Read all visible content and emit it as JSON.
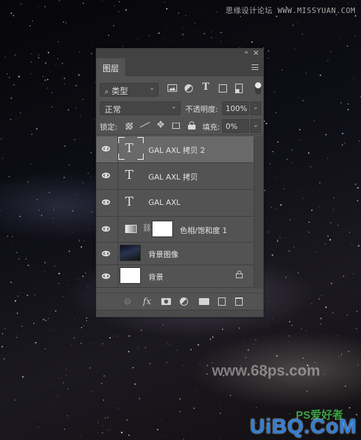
{
  "watermarks": {
    "top_right": "思缘设计论坛 WWW.MISSYUAN.COM",
    "center": "www.68ps.com",
    "bottom_ps": "PS爱好者",
    "bottom_uibq": "UiBQ.CoM"
  },
  "panel": {
    "collapse_icon": "«",
    "close_icon": "✕",
    "tab_label": "图层",
    "filter": {
      "search_icon": "⚲",
      "kind_label": "类型",
      "chevron": "⌄",
      "filter_icons": [
        "image-filter-icon",
        "adjustment-filter-icon",
        "type-filter-icon",
        "shape-filter-icon",
        "smart-object-filter-icon"
      ]
    },
    "blend": {
      "mode": "正常",
      "opacity_label": "不透明度:",
      "opacity_value": "100%"
    },
    "lock": {
      "label": "锁定:",
      "fill_label": "填充:",
      "fill_value": "0%"
    },
    "layers": [
      {
        "name": "GAL AXL 拷贝 2",
        "type": "text",
        "visible": true,
        "selected": true
      },
      {
        "name": "GAL AXL 拷贝",
        "type": "text",
        "visible": true,
        "selected": false
      },
      {
        "name": "GAL AXL",
        "type": "text",
        "visible": true,
        "selected": false
      },
      {
        "name": "色相/饱和度 1",
        "type": "adjustment",
        "visible": true,
        "selected": false
      },
      {
        "name": "背景图像",
        "type": "image",
        "visible": true,
        "selected": false
      },
      {
        "name": "背景",
        "type": "background",
        "visible": true,
        "selected": false,
        "locked": true
      }
    ],
    "footer": {
      "fx_label": "fx"
    }
  }
}
